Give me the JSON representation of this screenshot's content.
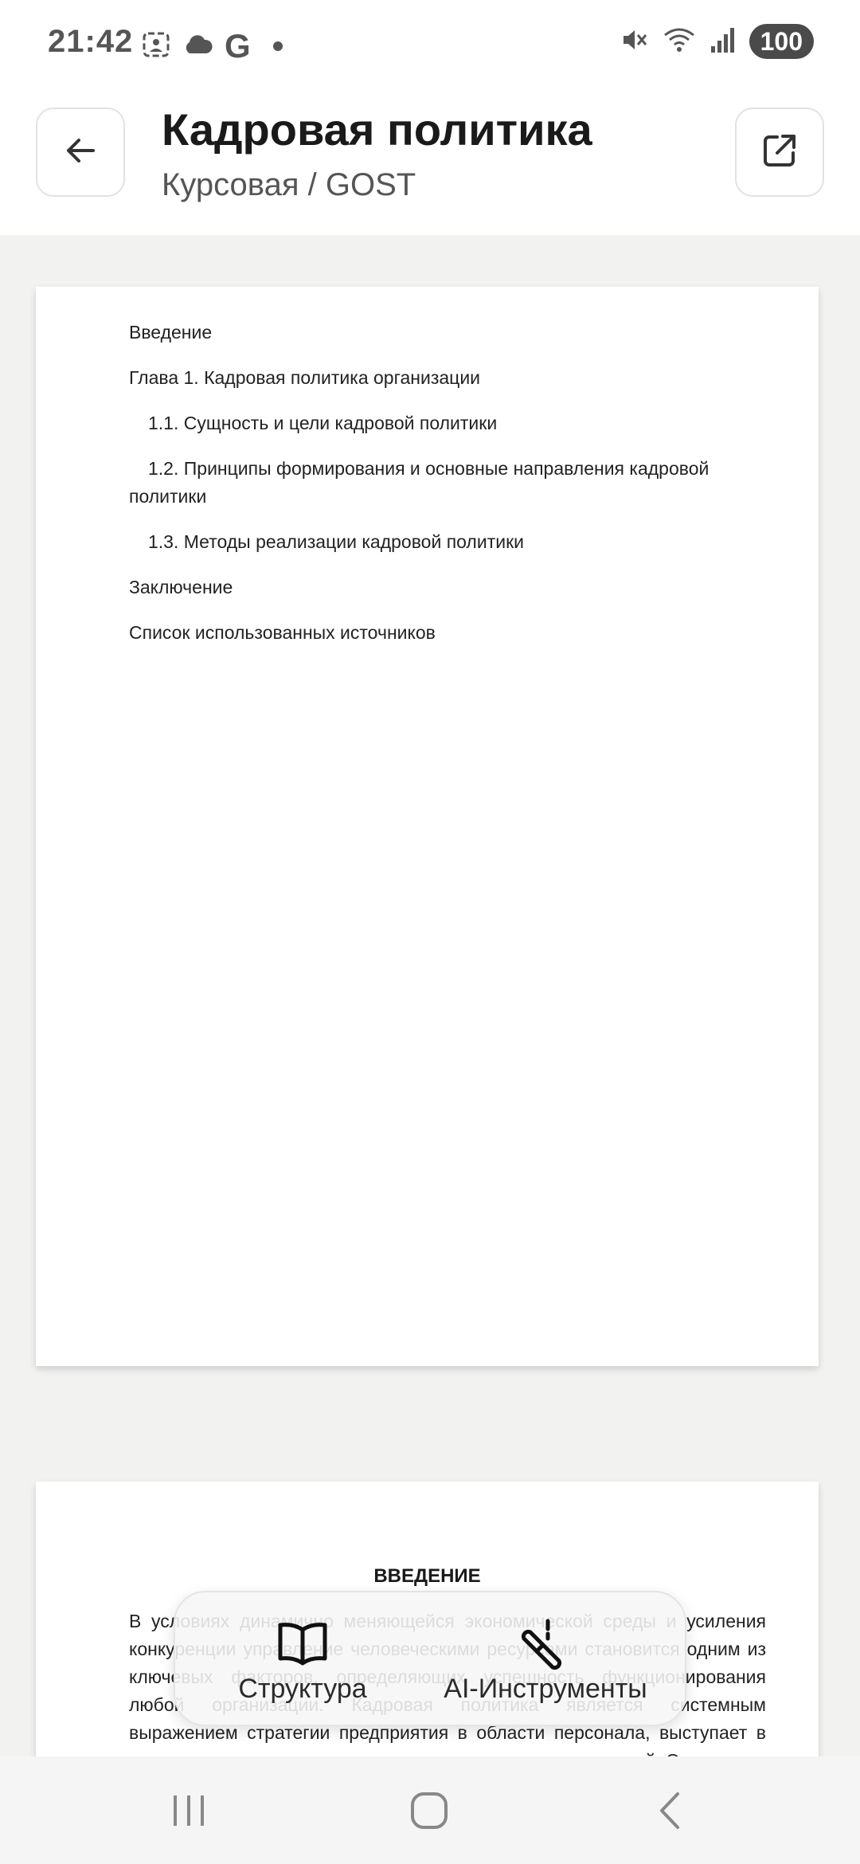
{
  "status_bar": {
    "time": "21:42",
    "battery": "100",
    "icons_left": [
      "gallery-icon",
      "cloud-icon",
      "google-icon",
      "dot-icon"
    ],
    "google_letter": "G",
    "icons_right": [
      "mute-icon",
      "wifi-icon",
      "signal-icon",
      "battery-icon"
    ]
  },
  "header": {
    "title": "Кадровая политика",
    "subtitle": "Курсовая / GOST",
    "back_icon": "arrow-left-icon",
    "external_icon": "external-link-icon"
  },
  "page1": {
    "toc": [
      "Введение",
      "Глава 1. Кадровая политика организации",
      "1.1. Сущность и цели кадровой политики",
      "1.2. Принципы формирования и основные направления кадровой политики",
      "1.3. Методы реализации кадровой политики",
      "Заключение",
      "Список использованных источников"
    ]
  },
  "page2": {
    "heading": "ВВЕДЕНИЕ",
    "text": "В условиях динамично меняющейся экономической среды и усиления конкуренции управление человеческими ресурсами становится одним из ключевых факторов, определяющих успешность функционирования любой организации. Кадровая политика является системным выражением стратегии предприятия в области персонала, выступает в качестве инструмента реализации этих стратегических целей. Она"
  },
  "toolbar": {
    "structure_label": "Структура",
    "ai_label": "AI-Инструменты",
    "structure_icon": "book-icon",
    "ai_icon": "magic-wand-icon"
  },
  "navbar": {
    "icons": [
      "recent-apps-icon",
      "home-icon",
      "back-icon"
    ]
  },
  "colors": {
    "background": "#f2f2f1",
    "page": "#ffffff",
    "text": "#1a1a1a",
    "muted": "#555555"
  }
}
